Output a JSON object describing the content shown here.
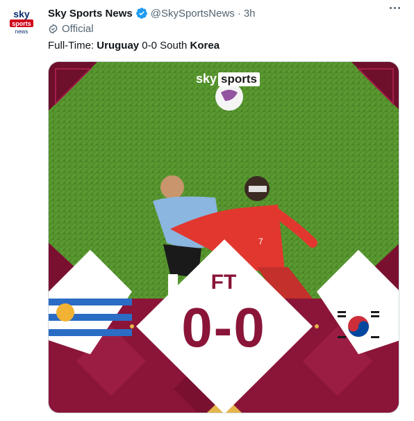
{
  "account": {
    "name": "Sky Sports News",
    "handle": "@SkySportsNews",
    "separator": "·",
    "time": "3h",
    "official_label": "Official",
    "avatar_text": {
      "line1": "sky",
      "line2": "sports",
      "line3": "news"
    }
  },
  "tweet": {
    "text_prefix": "Full-Time: ",
    "team1": "Uruguay",
    "score_text": " 0-0 South ",
    "team2": "Korea"
  },
  "graphic": {
    "brand_sky": "sky",
    "brand_sports": "sports",
    "status": "FT",
    "score": "0-0"
  },
  "colors": {
    "maroon": "#8a1538",
    "pitch": "#4f8f2a",
    "text_secondary": "#536471",
    "verified": "#1d9bf0"
  },
  "icons": {
    "verified": "verified-badge-icon",
    "official": "official-check-icon",
    "more": "more-options-icon"
  }
}
